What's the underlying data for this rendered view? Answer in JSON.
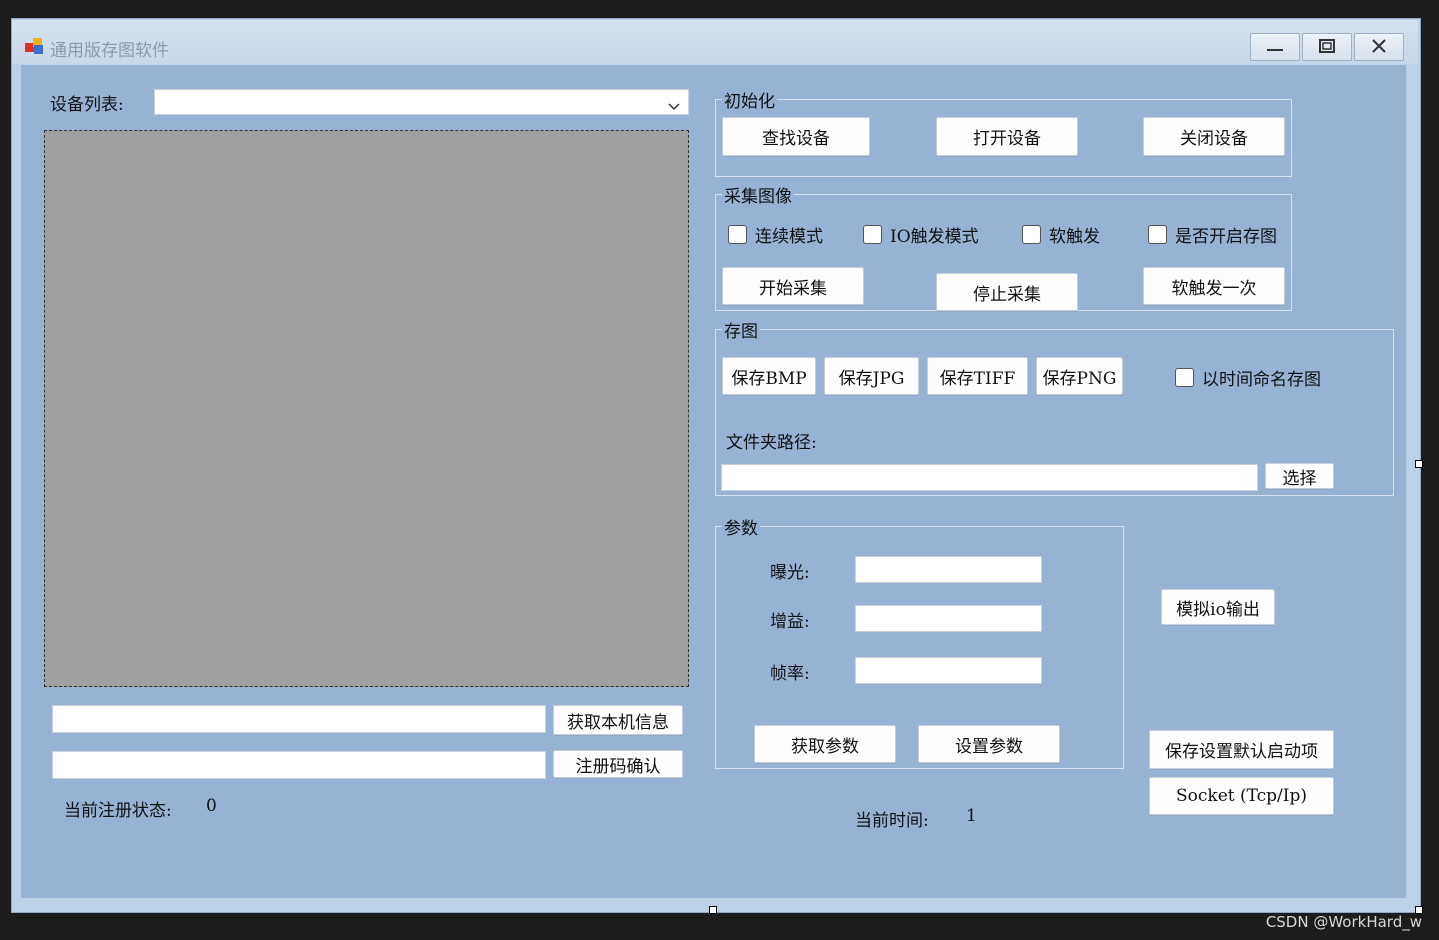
{
  "window": {
    "title": "通用版存图软件"
  },
  "device": {
    "label": "设备列表:",
    "selected": ""
  },
  "init_group": {
    "title": "初始化",
    "find": "查找设备",
    "open": "打开设备",
    "close": "关闭设备"
  },
  "capture_group": {
    "title": "采集图像",
    "continuous": "连续模式",
    "io_trigger": "IO触发模式",
    "soft_trigger": "软触发",
    "enable_save": "是否开启存图",
    "start": "开始采集",
    "stop": "停止采集",
    "soft_once": "软触发一次"
  },
  "save_group": {
    "title": "存图",
    "bmp": "保存BMP",
    "jpg": "保存JPG",
    "tiff": "保存TIFF",
    "png": "保存PNG",
    "name_by_time": "以时间命名存图",
    "folder_label": "文件夹路径:",
    "folder_value": "",
    "choose": "选择"
  },
  "params_group": {
    "title": "参数",
    "exposure_label": "曝光:",
    "exposure_value": "",
    "gain_label": "增益:",
    "gain_value": "",
    "framerate_label": "帧率:",
    "framerate_value": "",
    "get": "获取参数",
    "set": "设置参数"
  },
  "side": {
    "simulate_io": "模拟io输出",
    "save_default": "保存设置默认启动项",
    "socket": "Socket (Tcp/Ip)"
  },
  "license": {
    "machine_info_value": "",
    "machine_info_button": "获取本机信息",
    "reg_code_value": "",
    "reg_confirm_button": "注册码确认",
    "status_label": "当前注册状态:",
    "status_value": "0"
  },
  "time": {
    "label": "当前时间:",
    "value": "1"
  },
  "watermark": "CSDN @WorkHard_w"
}
